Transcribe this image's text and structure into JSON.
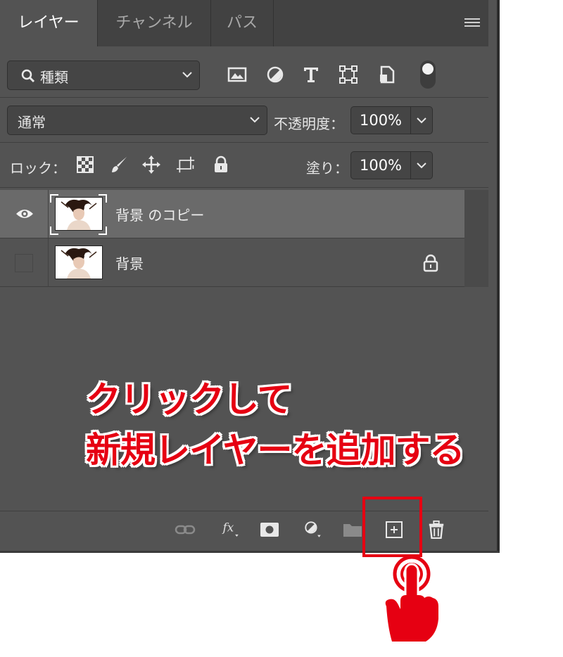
{
  "tabs": [
    {
      "label": "レイヤー",
      "active": true
    },
    {
      "label": "チャンネル",
      "active": false
    },
    {
      "label": "パス",
      "active": false
    }
  ],
  "filter": {
    "kind_label": "種類"
  },
  "blend": {
    "mode": "通常",
    "opacity_label": "不透明度：",
    "opacity_value": "100%"
  },
  "lock": {
    "label": "ロック：",
    "fill_label": "塗り：",
    "fill_value": "100%"
  },
  "layers": [
    {
      "name": "背景 のコピー",
      "visible": true,
      "selected": true,
      "locked": false
    },
    {
      "name": "背景",
      "visible": false,
      "selected": false,
      "locked": true
    }
  ],
  "annotation": {
    "line1": "クリックして",
    "line2": "新規レイヤーを追加する",
    "color": "#e60012"
  },
  "colors": {
    "panel": "#535353",
    "tabbar": "#424242",
    "selected_layer": "#6a6a6a"
  }
}
